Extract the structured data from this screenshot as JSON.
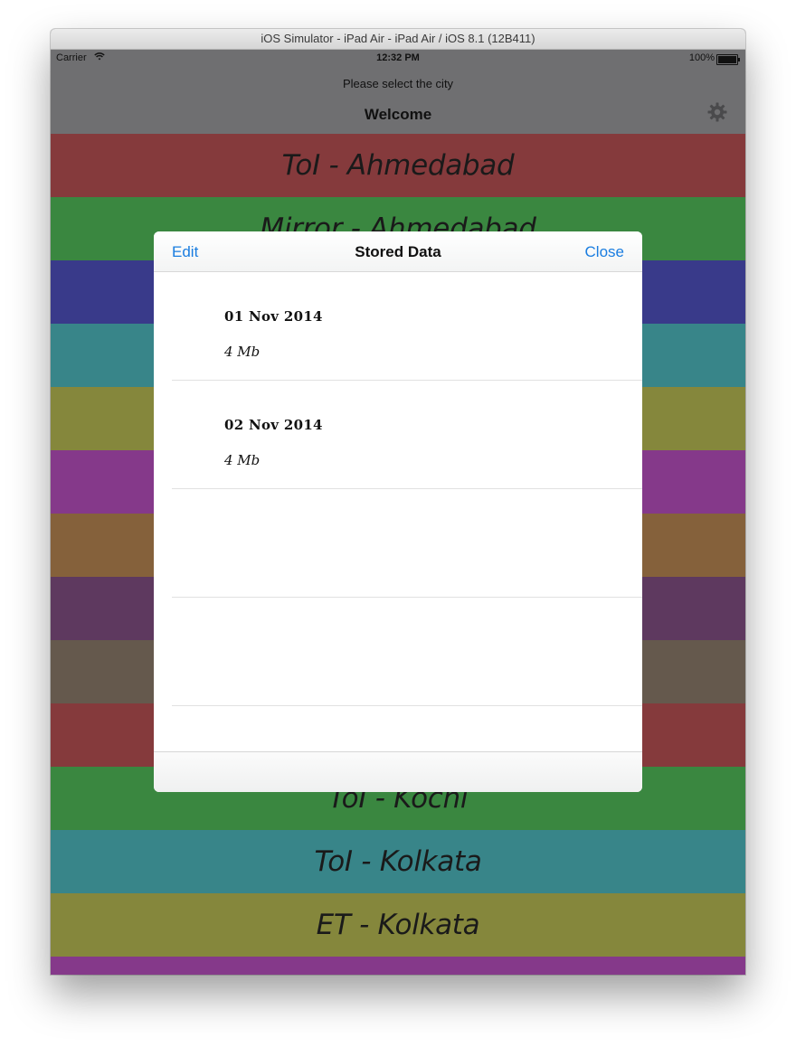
{
  "window": {
    "title": "iOS Simulator - iPad Air - iPad Air / iOS 8.1 (12B411)"
  },
  "status_bar": {
    "carrier": "Carrier",
    "wifi_icon": "wifi-icon",
    "time": "12:32 PM",
    "battery": "100%"
  },
  "nav": {
    "prompt": "Please select the city",
    "title": "Welcome",
    "settings_icon": "gear-icon"
  },
  "cities": [
    {
      "label": "ToI - Ahmedabad",
      "color": "#853a3c"
    },
    {
      "label": "Mirror - Ahmedabad",
      "color": "#3a8740"
    },
    {
      "label": "",
      "color": "#393a8a"
    },
    {
      "label": "",
      "color": "#388589"
    },
    {
      "label": "",
      "color": "#85873c"
    },
    {
      "label": "",
      "color": "#85398a"
    },
    {
      "label": "",
      "color": "#85613b"
    },
    {
      "label": "",
      "color": "#5e395f"
    },
    {
      "label": "",
      "color": "#65594d"
    },
    {
      "label": "",
      "color": "#853a3c"
    },
    {
      "label": "ToI - Kochi",
      "color": "#3a8740"
    },
    {
      "label": "ToI - Kolkata",
      "color": "#388589"
    },
    {
      "label": "ET - Kolkata",
      "color": "#85873c"
    },
    {
      "label": "",
      "color": "#85398a"
    }
  ],
  "modal": {
    "edit_label": "Edit",
    "title": "Stored Data",
    "close_label": "Close",
    "rows": [
      {
        "date": "01 Nov 2014",
        "size": "4 Mb"
      },
      {
        "date": "02 Nov 2014",
        "size": "4 Mb"
      }
    ]
  }
}
